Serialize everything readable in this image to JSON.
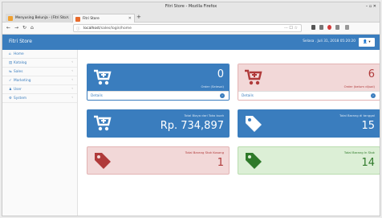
{
  "browser": {
    "window_title": "Fitri Store - Mozilla Firefox",
    "tabs": [
      {
        "label": "Menyusing Belunja - (Fitri Sto...",
        "active": false,
        "favicon_color": "#f0a030"
      },
      {
        "label": "Fitri Store",
        "active": true,
        "favicon_color": "#e86a2b"
      }
    ],
    "new_tab": "+",
    "url_info": "ⓘ",
    "url_host": "localhost",
    "url_path": "/sales/login/home",
    "url_tools": "··· ☐ ☆",
    "window_controls": "–  ▫  ✕"
  },
  "app": {
    "brand": "Fitri Store",
    "greeting": "Selasa . Juli 31, 2018 05:20:20",
    "user_menu": "👤 ▾",
    "sidebar": [
      {
        "label": "Home",
        "icon": "⌂"
      },
      {
        "label": "Katalog",
        "icon": "▤",
        "arrow": "‹"
      },
      {
        "label": "Sales",
        "icon": "⇆",
        "arrow": "‹"
      },
      {
        "label": "Marketing",
        "icon": "✓",
        "arrow": "‹"
      },
      {
        "label": "User",
        "icon": "♟",
        "arrow": "‹"
      },
      {
        "label": "System",
        "icon": "⚙",
        "arrow": "‹"
      }
    ],
    "panels": [
      {
        "id": "order-done",
        "value": "0",
        "label": "Order (Selesai)",
        "footer": "Details",
        "theme": "blue"
      },
      {
        "id": "order-pending",
        "value": "6",
        "label": "Order (belum dijual)",
        "footer": "Details",
        "theme": "red"
      },
      {
        "id": "total-biaya",
        "value": "Rp. 734,897",
        "label": "Total Biaya dari Toko buah",
        "theme": "blue"
      },
      {
        "id": "barang-terjual",
        "value": "15",
        "label": "Total Barang di tanggal",
        "theme": "blue"
      },
      {
        "id": "barang-habis",
        "value": "1",
        "label": "Total Barang Stok Kosong",
        "theme": "red"
      },
      {
        "id": "barang-stok",
        "value": "14",
        "label": "Total Barang In Stok",
        "theme": "green"
      }
    ]
  },
  "theme": {
    "blue": "#3a7dbe",
    "red_bg": "#f2d8d8",
    "red_fg": "#b03a3a",
    "green_bg": "#dcefd6",
    "green_fg": "#2f7a2a"
  }
}
